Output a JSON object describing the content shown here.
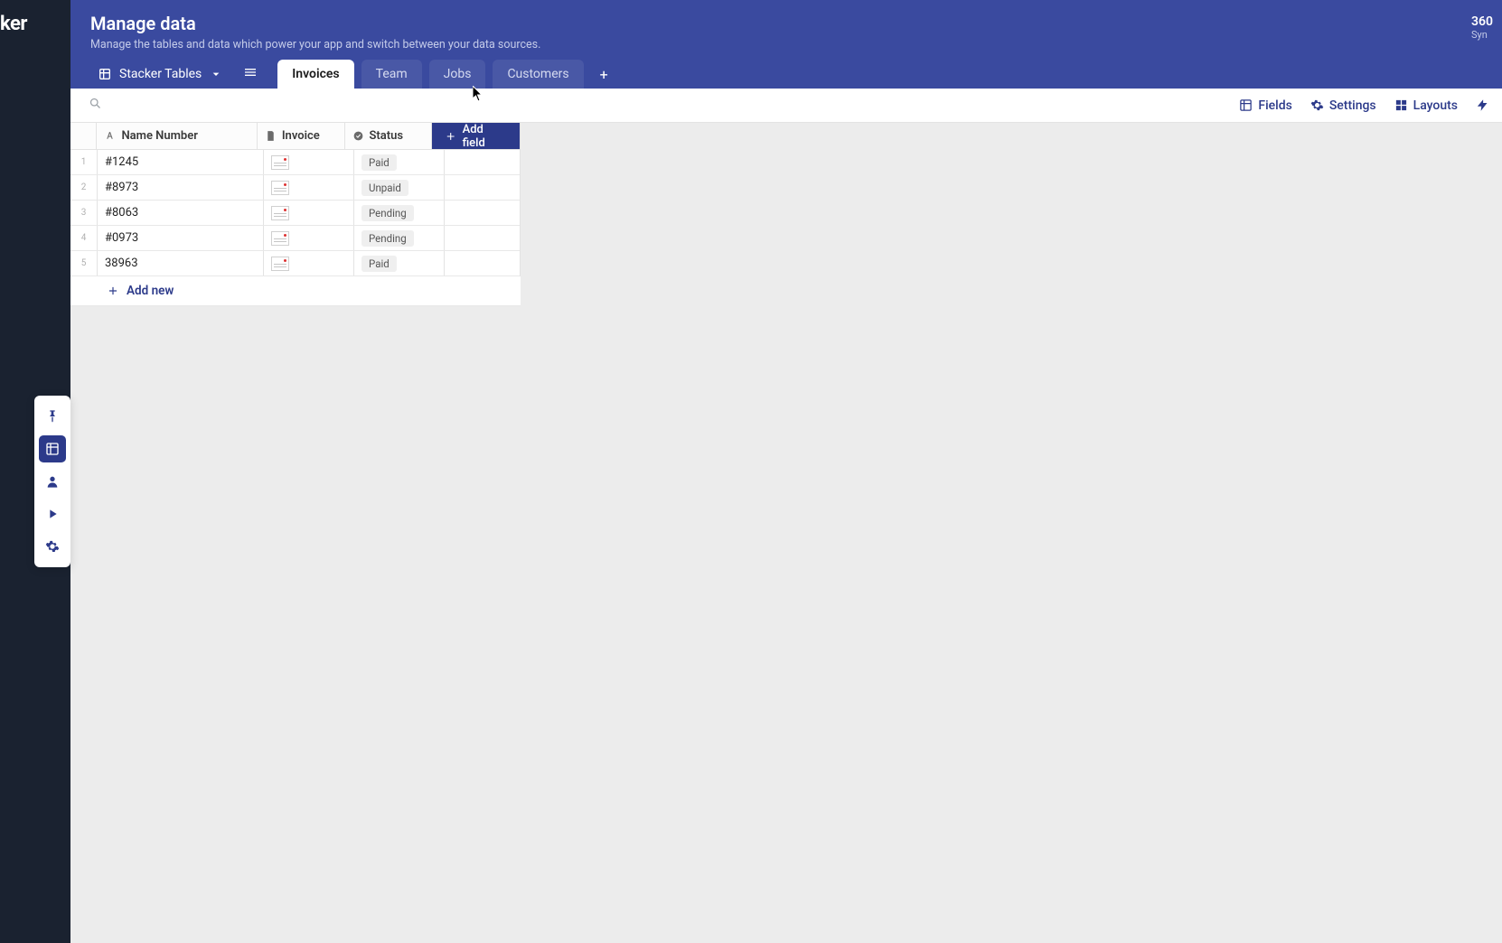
{
  "branding": {
    "logo_fragment": "ker"
  },
  "header": {
    "title": "Manage data",
    "subtitle": "Manage the tables and data which power your app and switch between your data sources.",
    "right_num": "360",
    "right_sub": "Syn"
  },
  "datasource": {
    "name": "Stacker Tables"
  },
  "tabs": [
    {
      "label": "Invoices",
      "active": true
    },
    {
      "label": "Team",
      "active": false
    },
    {
      "label": "Jobs",
      "active": false
    },
    {
      "label": "Customers",
      "active": false
    }
  ],
  "toolbar": {
    "fields": "Fields",
    "settings": "Settings",
    "layouts": "Layouts"
  },
  "columns": {
    "name_number": "Name Number",
    "invoice": "Invoice",
    "status": "Status",
    "add_field": "Add field"
  },
  "rows": [
    {
      "num": "1",
      "name": "#1245",
      "status": "Paid"
    },
    {
      "num": "2",
      "name": "#8973",
      "status": "Unpaid"
    },
    {
      "num": "3",
      "name": "#8063",
      "status": "Pending"
    },
    {
      "num": "4",
      "name": "#0973",
      "status": "Pending"
    },
    {
      "num": "5",
      "name": "38963",
      "status": "Paid"
    }
  ],
  "actions": {
    "add_new": "Add new"
  }
}
